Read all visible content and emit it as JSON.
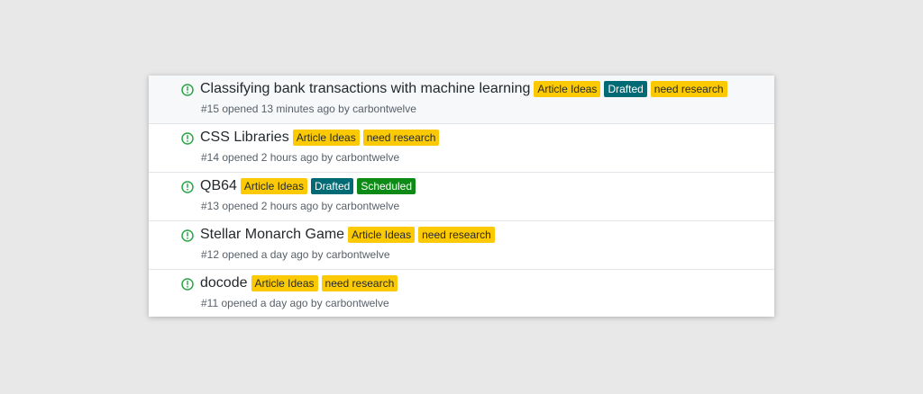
{
  "issues": [
    {
      "title": "Classifying bank transactions with machine learning",
      "labels": [
        {
          "text": "Article Ideas",
          "color": "#fbca04"
        },
        {
          "text": "Drafted",
          "color": "#006b75"
        },
        {
          "text": "need research",
          "color": "#fbca04"
        }
      ],
      "number": "#15",
      "opened": "opened 13 minutes ago by",
      "author": "carbontwelve"
    },
    {
      "title": "CSS Libraries",
      "labels": [
        {
          "text": "Article Ideas",
          "color": "#fbca04"
        },
        {
          "text": "need research",
          "color": "#fbca04"
        }
      ],
      "number": "#14",
      "opened": "opened 2 hours ago by",
      "author": "carbontwelve"
    },
    {
      "title": "QB64",
      "labels": [
        {
          "text": "Article Ideas",
          "color": "#fbca04"
        },
        {
          "text": "Drafted",
          "color": "#006b75"
        },
        {
          "text": "Scheduled",
          "color": "#0e8a16"
        }
      ],
      "number": "#13",
      "opened": "opened 2 hours ago by",
      "author": "carbontwelve"
    },
    {
      "title": "Stellar Monarch Game",
      "labels": [
        {
          "text": "Article Ideas",
          "color": "#fbca04"
        },
        {
          "text": "need research",
          "color": "#fbca04"
        }
      ],
      "number": "#12",
      "opened": "opened a day ago by",
      "author": "carbontwelve"
    },
    {
      "title": "docode",
      "labels": [
        {
          "text": "Article Ideas",
          "color": "#fbca04"
        },
        {
          "text": "need research",
          "color": "#fbca04"
        }
      ],
      "number": "#11",
      "opened": "opened a day ago by",
      "author": "carbontwelve"
    }
  ],
  "icons": {
    "issue": "issue-opened-icon",
    "issue_color": "#28a745"
  }
}
